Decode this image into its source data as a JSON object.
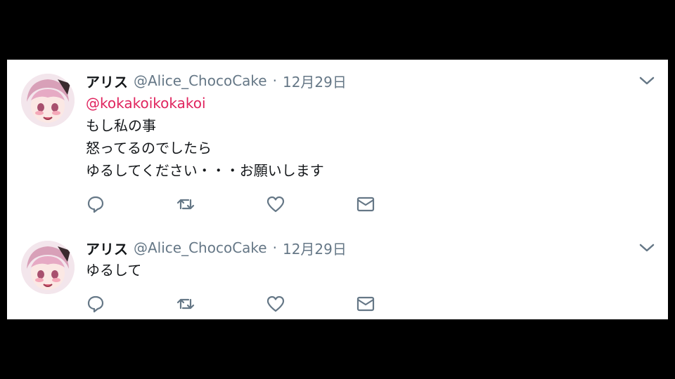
{
  "tweets": [
    {
      "display_name": "アリス",
      "handle": "@Alice_ChocoCake",
      "separator": "·",
      "date": "12月29日",
      "mention": "@kokakoikokakoi",
      "lines": [
        "もし私の事",
        "怒ってるのでしたら",
        "ゆるしてください・・・お願いします"
      ]
    },
    {
      "display_name": "アリス",
      "handle": "@Alice_ChocoCake",
      "separator": "·",
      "date": "12月29日",
      "lines": [
        "ゆるして"
      ]
    }
  ],
  "icons": {
    "caret": "chevron-down-icon",
    "reply": "reply-icon",
    "retweet": "retweet-icon",
    "like": "heart-icon",
    "dm": "envelope-icon"
  },
  "colors": {
    "name": "#14171a",
    "meta": "#657786",
    "mention": "#e0245e",
    "icon": "#657786",
    "background": "#000000",
    "panel": "#ffffff"
  }
}
